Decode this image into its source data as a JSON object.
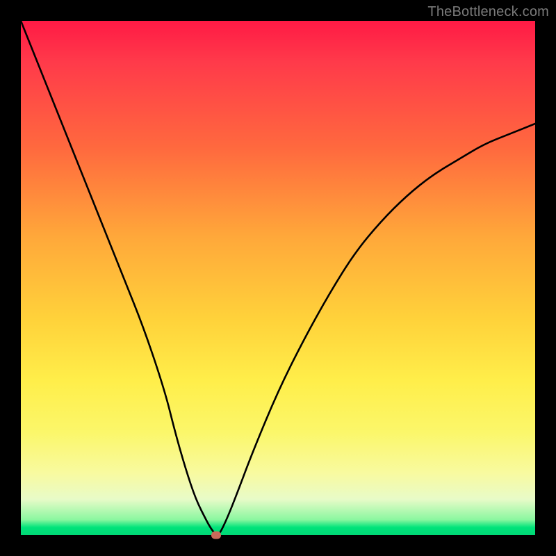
{
  "watermark": "TheBottleneck.com",
  "chart_data": {
    "type": "line",
    "title": "",
    "xlabel": "",
    "ylabel": "",
    "xlim": [
      0,
      100
    ],
    "ylim": [
      0,
      100
    ],
    "series": [
      {
        "name": "bottleneck-curve",
        "x": [
          0,
          4,
          8,
          12,
          16,
          20,
          24,
          28,
          30,
          32,
          34,
          36,
          37,
          38,
          38.5,
          40,
          42,
          45,
          50,
          55,
          60,
          65,
          70,
          75,
          80,
          85,
          90,
          95,
          100
        ],
        "values": [
          100,
          90,
          80,
          70,
          60,
          50,
          40,
          28,
          20,
          13,
          7,
          3,
          1.2,
          0,
          0,
          3,
          8,
          16,
          28,
          38,
          47,
          55,
          61,
          66,
          70,
          73,
          76,
          78,
          80
        ]
      }
    ],
    "marker": {
      "x": 38,
      "y": 0,
      "color": "#c96a5a"
    },
    "gradient_stops": [
      {
        "pos": 0,
        "color": "#ff1a45"
      },
      {
        "pos": 0.42,
        "color": "#ffa83a"
      },
      {
        "pos": 0.7,
        "color": "#ffee4a"
      },
      {
        "pos": 0.93,
        "color": "#e8fbc8"
      },
      {
        "pos": 1.0,
        "color": "#00d876"
      }
    ]
  }
}
